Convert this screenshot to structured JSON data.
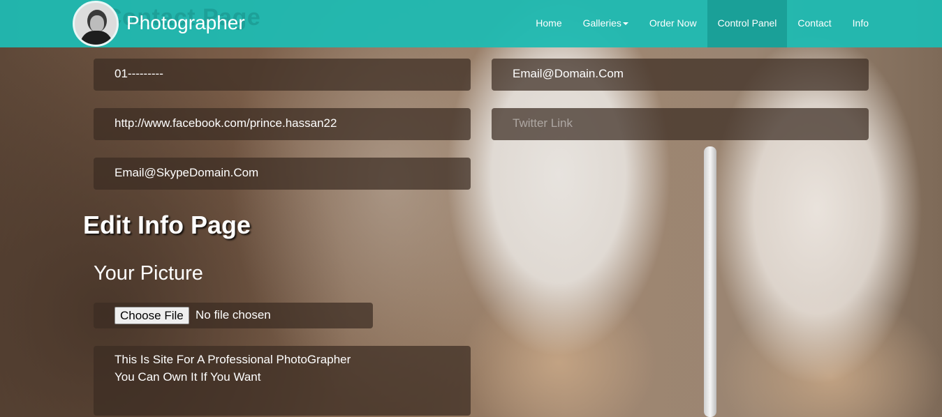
{
  "navbar": {
    "ghost_title": "Contact Page",
    "brand": "Photographer",
    "items": [
      {
        "label": "Home",
        "active": false,
        "dropdown": false
      },
      {
        "label": "Galleries",
        "active": false,
        "dropdown": true
      },
      {
        "label": "Order Now",
        "active": false,
        "dropdown": false
      },
      {
        "label": "Control Panel",
        "active": true,
        "dropdown": false
      },
      {
        "label": "Contact",
        "active": false,
        "dropdown": false
      },
      {
        "label": "Info",
        "active": false,
        "dropdown": false
      }
    ]
  },
  "contact_form": {
    "phone": {
      "value": "01---------",
      "placeholder": ""
    },
    "email": {
      "value": "Email@Domain.Com",
      "placeholder": ""
    },
    "facebook": {
      "value": "http://www.facebook.com/prince.hassan22",
      "placeholder": ""
    },
    "twitter": {
      "value": "",
      "placeholder": "Twitter Link"
    },
    "skype": {
      "value": "Email@SkypeDomain.Com",
      "placeholder": ""
    }
  },
  "info_page": {
    "heading": "Edit Info Page",
    "picture_heading": "Your Picture",
    "file_button": "Choose File",
    "file_status": "No file chosen",
    "about_line1": "This Is Site For A Professional PhotoGrapher",
    "about_line2": "You Can Own It If You Want"
  },
  "colors": {
    "navbar": "#1fbab2",
    "navbar_active": "#1aa098",
    "field_bg": "#3c2d23"
  }
}
